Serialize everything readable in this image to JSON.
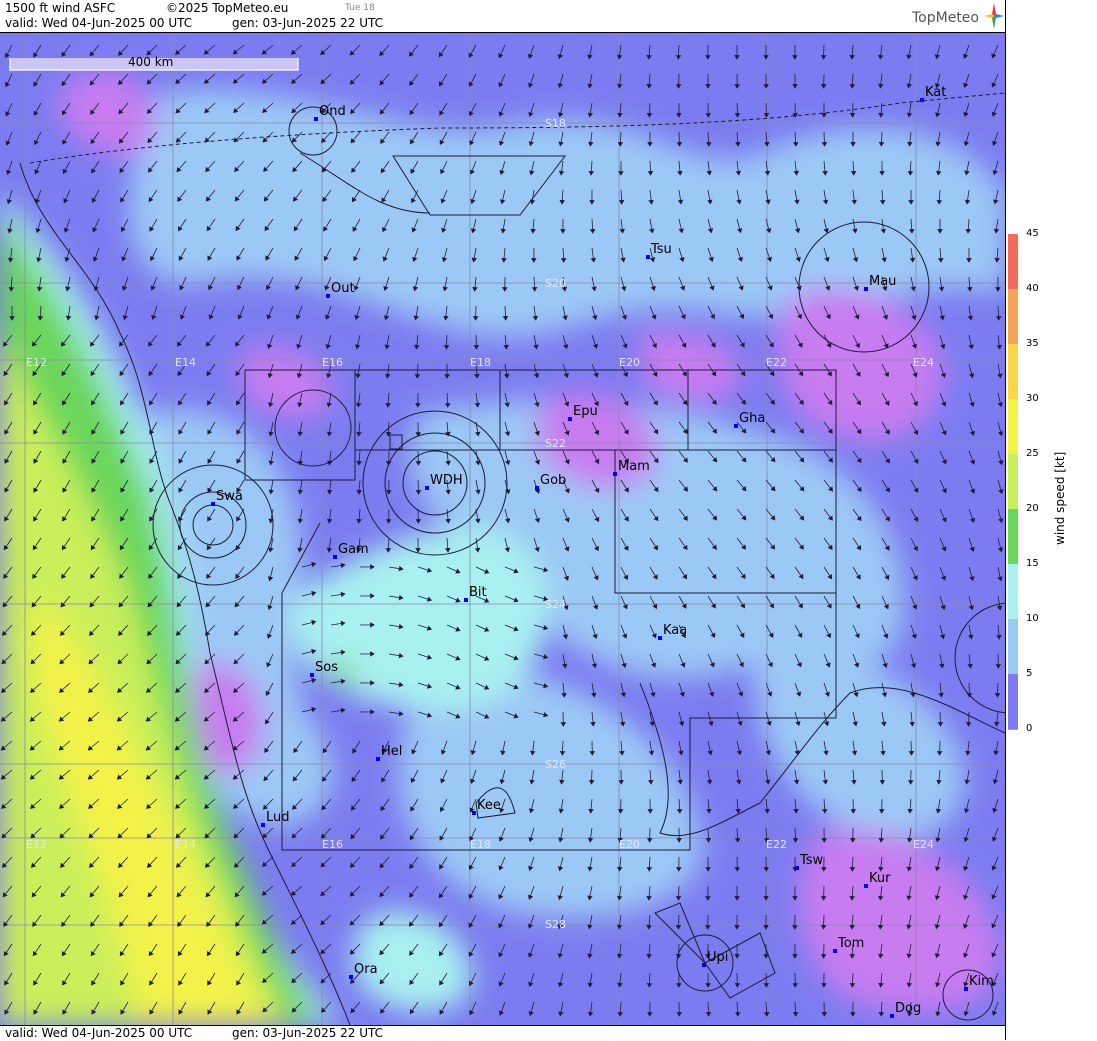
{
  "header": {
    "product": "1500 ft wind ASFC",
    "copyright": "©2025 TopMeteo.eu",
    "day_hint": "Tue 18",
    "valid": "valid:  Wed  04-Jun-2025  00 UTC",
    "generated": "gen: 03-Jun-2025 22 UTC"
  },
  "footer": {
    "valid": "valid:  Wed  04-Jun-2025  00 UTC",
    "generated": "gen: 03-Jun-2025 22 UTC"
  },
  "brand": {
    "name": "TopMeteo",
    "icon": "compass-star-icon"
  },
  "scale_bar": {
    "label": "400 km"
  },
  "colorbar": {
    "title": "wind speed [kt]",
    "ticks": [
      "45",
      "40",
      "35",
      "30",
      "25",
      "20",
      "15",
      "10",
      "5",
      "0"
    ],
    "colors": [
      "#f26b5b",
      "#f7a35a",
      "#fbd649",
      "#f2f248",
      "#c9ef5a",
      "#6ad65a",
      "#a9f0f0",
      "#9cc8f5",
      "#7c7cf0",
      "#c77bf0"
    ]
  },
  "grid_labels": {
    "longitudes": [
      "E12",
      "E14",
      "E16",
      "E18",
      "E20",
      "E22",
      "E24"
    ],
    "latitudes": [
      "S18",
      "S20",
      "S22",
      "S24",
      "S26",
      "S28"
    ]
  },
  "places": [
    "Ond",
    "Kat",
    "Tsu",
    "Mau",
    "Out",
    "Epu",
    "Gha",
    "Mam",
    "Swa",
    "WDH",
    "Gob",
    "Gam",
    "Bit",
    "Kaa",
    "Sos",
    "Hel",
    "Lud",
    "Kee",
    "Tsw",
    "Kur",
    "Tom",
    "Upi",
    "Ora",
    "Kim",
    "Dog"
  ],
  "colors": {
    "calm": "#c77bf0",
    "light": "#7c7cf0",
    "moderate": "#9cc8f5",
    "fresh": "#a9f0f0",
    "strong": "#6ad65a",
    "stronger": "#c9ef5a",
    "gale": "#f2f248"
  }
}
